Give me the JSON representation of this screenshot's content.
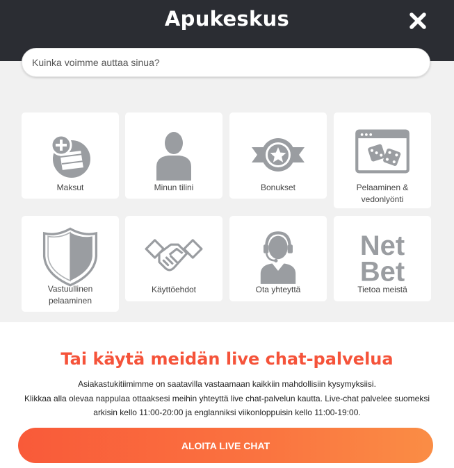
{
  "header": {
    "title": "Apukeskus",
    "close_icon": "close-icon"
  },
  "search": {
    "placeholder": "Kuinka voimme auttaa sinua?"
  },
  "categories": [
    {
      "label": "Maksut",
      "icon": "wallet-plus-icon"
    },
    {
      "label": "Minun tilini",
      "icon": "user-icon"
    },
    {
      "label": "Bonukset",
      "icon": "star-badge-icon"
    },
    {
      "label_line1": "Pelaaminen &",
      "label_line2": "vedonlyönti",
      "icon": "dice-window-icon"
    },
    {
      "label_line1": "Vastuullinen",
      "label_line2": "pelaaminen",
      "icon": "shield-icon"
    },
    {
      "label": "Käyttöehdot",
      "icon": "handshake-icon"
    },
    {
      "label": "Ota yhteyttä",
      "icon": "headset-agent-icon"
    },
    {
      "label": "Tietoa meistä",
      "icon": "netbet-logo-icon",
      "logo_line1": "Net",
      "logo_line2": "Bet"
    }
  ],
  "live_chat": {
    "title": "Tai käytä meidän live chat-palvelua",
    "desc_line1": "Asiakastukitiimimme on saatavilla vastaamaan kaikkiin mahdollisiin kysymyksiisi.",
    "desc_line2": "Klikkaa alla olevaa nappulaa ottaaksesi meihin yhteyttä live chat-palvelun kautta. Live-chat palvelee suomeksi",
    "desc_line3": "arkisin kello 11:00-20:00 ja englanniksi viikonloppuisin kello 11:00-19:00.",
    "button_label": "ALOITA LIVE CHAT"
  },
  "colors": {
    "header_bg": "#2b2d33",
    "icon_grey": "#9a9da1",
    "accent": "#f5533a"
  }
}
